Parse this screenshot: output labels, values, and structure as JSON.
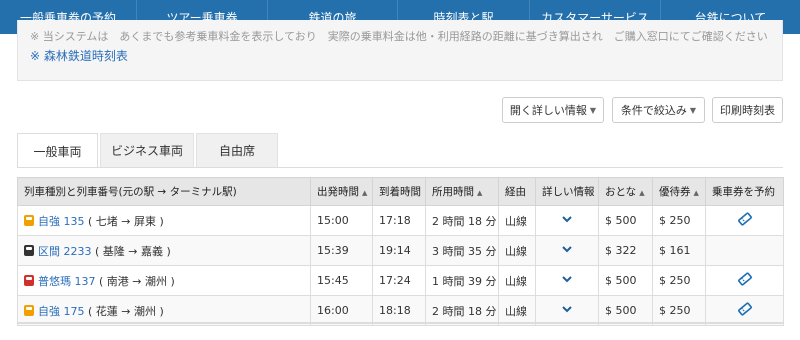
{
  "nav": {
    "items": [
      {
        "label": "一般乗車券の予約"
      },
      {
        "label": "ツアー乗車券"
      },
      {
        "label": "鉄道の旅"
      },
      {
        "label": "時刻表と駅"
      },
      {
        "label": "カスタマーサービス"
      },
      {
        "label": "台鉄について"
      }
    ]
  },
  "notice": {
    "cut_text": "※ 当システムは　あくまでも参考乗車料金を表示しており　実際の乗車料金は他・利用経路の距離に基づき算出され　ご購入窓口にてご確認ください",
    "forest_link": "※ 森林鉄道時刻表"
  },
  "tools": {
    "details": "開く詳しい情報",
    "filter": "条件で絞込み",
    "print": "印刷時刻表"
  },
  "tabs": [
    "一般車両",
    "ビジネス車両",
    "自由席"
  ],
  "table": {
    "headers": {
      "train": "列車種別と列車番号(元の駅 → ターミナル駅)",
      "depart": "出発時間",
      "arrive": "到着時間",
      "duration": "所用時間",
      "via": "経由",
      "detail": "詳しい情報",
      "adult": "おとな",
      "discount": "優待券",
      "book": "乗車券を予約"
    },
    "rows": [
      {
        "type_color": "#f0a000",
        "train": "自強 135",
        "route": "( 七堵 → 屏東 )",
        "depart": "15:00",
        "arrive": "17:18",
        "duration": "2 時間 18 分",
        "via": "山線",
        "adult": "$ 500",
        "discount": "$ 250",
        "bookable": true
      },
      {
        "type_color": "#333333",
        "train": "区間 2233",
        "route": "( 基隆 → 嘉義 )",
        "depart": "15:39",
        "arrive": "19:14",
        "duration": "3 時間 35 分",
        "via": "山線",
        "adult": "$ 322",
        "discount": "$ 161",
        "bookable": false
      },
      {
        "type_color": "#d0312d",
        "train": "普悠瑪 137",
        "route": "( 南港 → 潮州 )",
        "depart": "15:45",
        "arrive": "17:24",
        "duration": "1 時間 39 分",
        "via": "山線",
        "adult": "$ 500",
        "discount": "$ 250",
        "bookable": true
      },
      {
        "type_color": "#f0a000",
        "train": "自強 175",
        "route": "( 花蓮 → 潮州 )",
        "depart": "16:00",
        "arrive": "18:18",
        "duration": "2 時間 18 分",
        "via": "山線",
        "adult": "$ 500",
        "discount": "$ 250",
        "bookable": true
      }
    ]
  },
  "colors": {
    "nav_bg": "#2470ad",
    "link": "#2a6ebb",
    "ticket_icon": "#1f6fb4"
  }
}
